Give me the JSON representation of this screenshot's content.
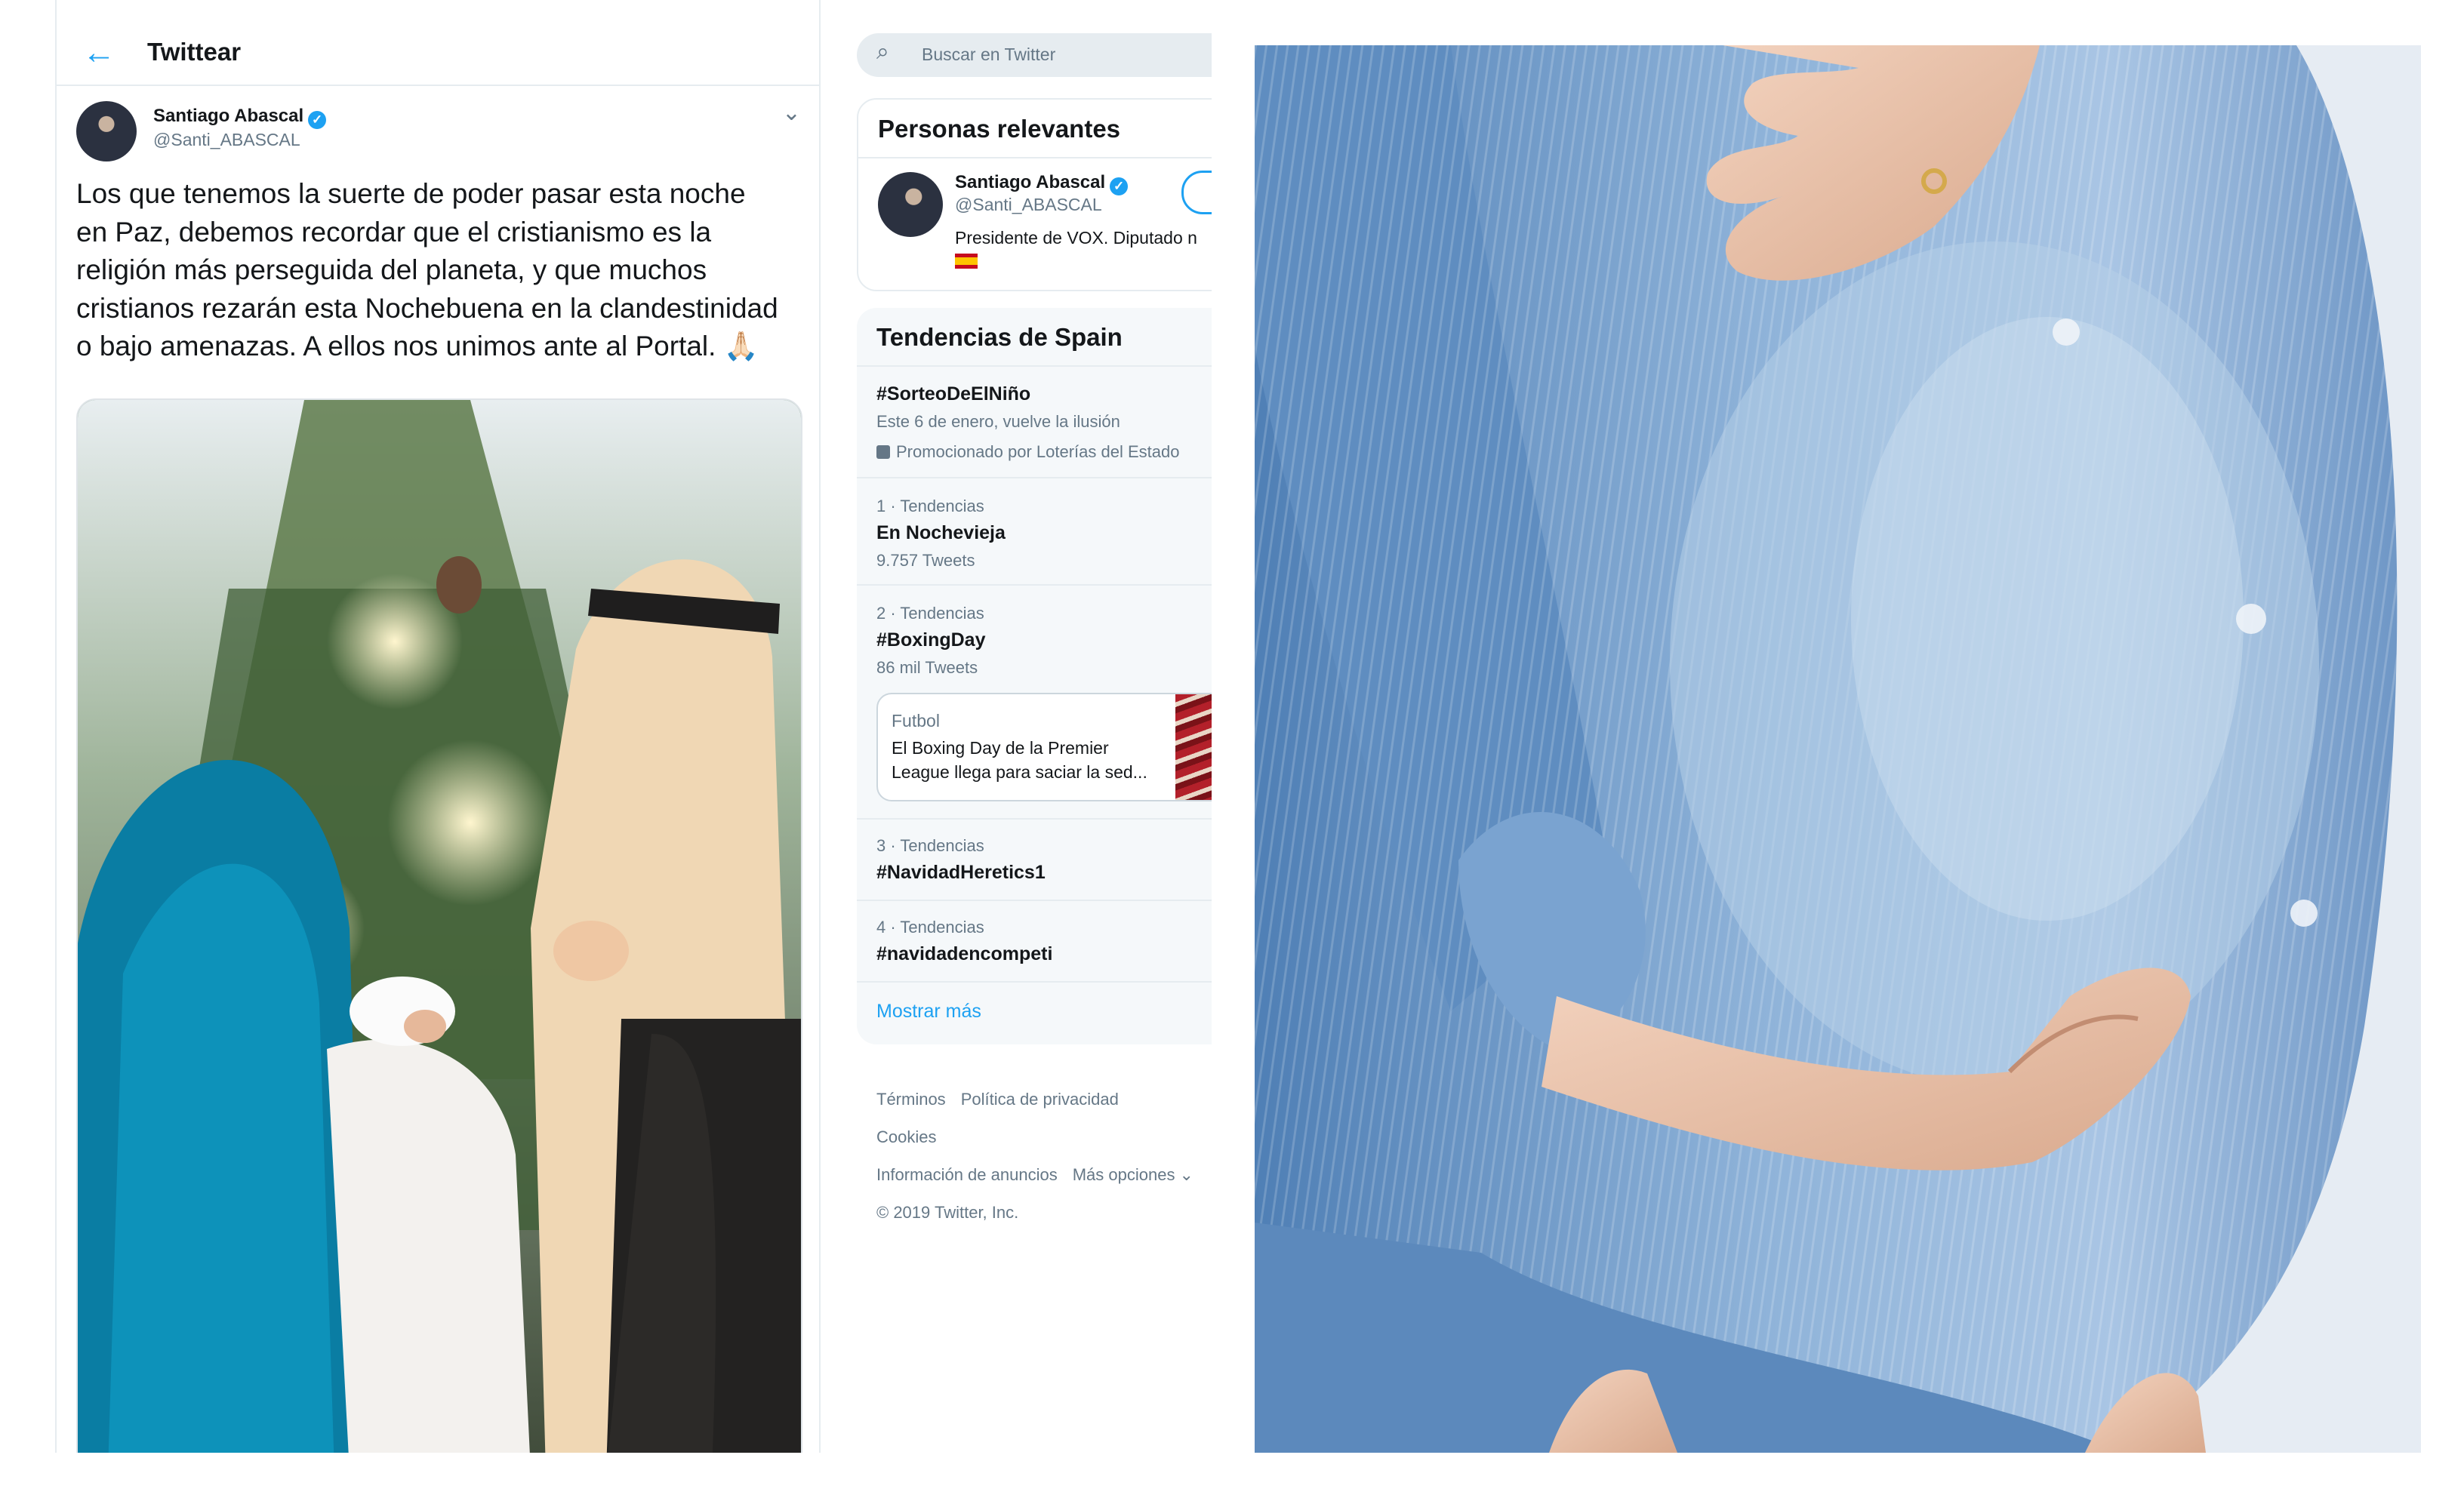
{
  "tweet_column": {
    "header_title": "Twittear",
    "author_name": "Santiago Abascal",
    "author_handle": "@Santi_ABASCAL",
    "tweet_lines": [
      "Los que tenemos la suerte de poder pasar esta noche",
      "en Paz, debemos recordar que el cristianismo es la",
      "religión más perseguida del planeta, y que muchos",
      "cristianos rezarán esta Nochebuena en la clandestinidad",
      "o bajo amenazas. A ellos nos unimos ante al Portal. 🙏🏻"
    ]
  },
  "sidebar": {
    "search_placeholder": "Buscar en Twitter",
    "relevant": {
      "title": "Personas relevantes",
      "name": "Santiago Abascal",
      "handle": "@Santi_ABASCAL",
      "bio": "Presidente de VOX. Diputado n"
    },
    "trends": {
      "title": "Tendencias de Spain",
      "promoted": {
        "name": "#SorteoDeElNiño",
        "description": "Este 6 de enero, vuelve la ilusión",
        "promoted_by": "Promocionado por Loterías del Estado"
      },
      "items": [
        {
          "meta": "1 · Tendencias",
          "name": "En Nochevieja",
          "count": "9.757 Tweets"
        },
        {
          "meta": "2 · Tendencias",
          "name": "#BoxingDay",
          "count": "86 mil Tweets"
        },
        {
          "meta": "3 · Tendencias",
          "name": "#NavidadHeretics1",
          "count": ""
        },
        {
          "meta": "4 · Tendencias",
          "name": "#navidadencompeti",
          "count": ""
        }
      ],
      "news_card": {
        "category": "Futbol",
        "line1": "El Boxing Day de la Premier",
        "line2": "League llega para saciar la sed..."
      },
      "show_more": "Mostrar más"
    },
    "footer": {
      "links": [
        "Términos",
        "Política de privacidad",
        "Cookies",
        "Información de anuncios",
        "Más opciones ⌄"
      ],
      "copyright": "© 2019 Twitter, Inc."
    }
  },
  "colors": {
    "accent": "#1da1f2",
    "muted": "#657786",
    "panel_bg": "#f5f8fa"
  }
}
